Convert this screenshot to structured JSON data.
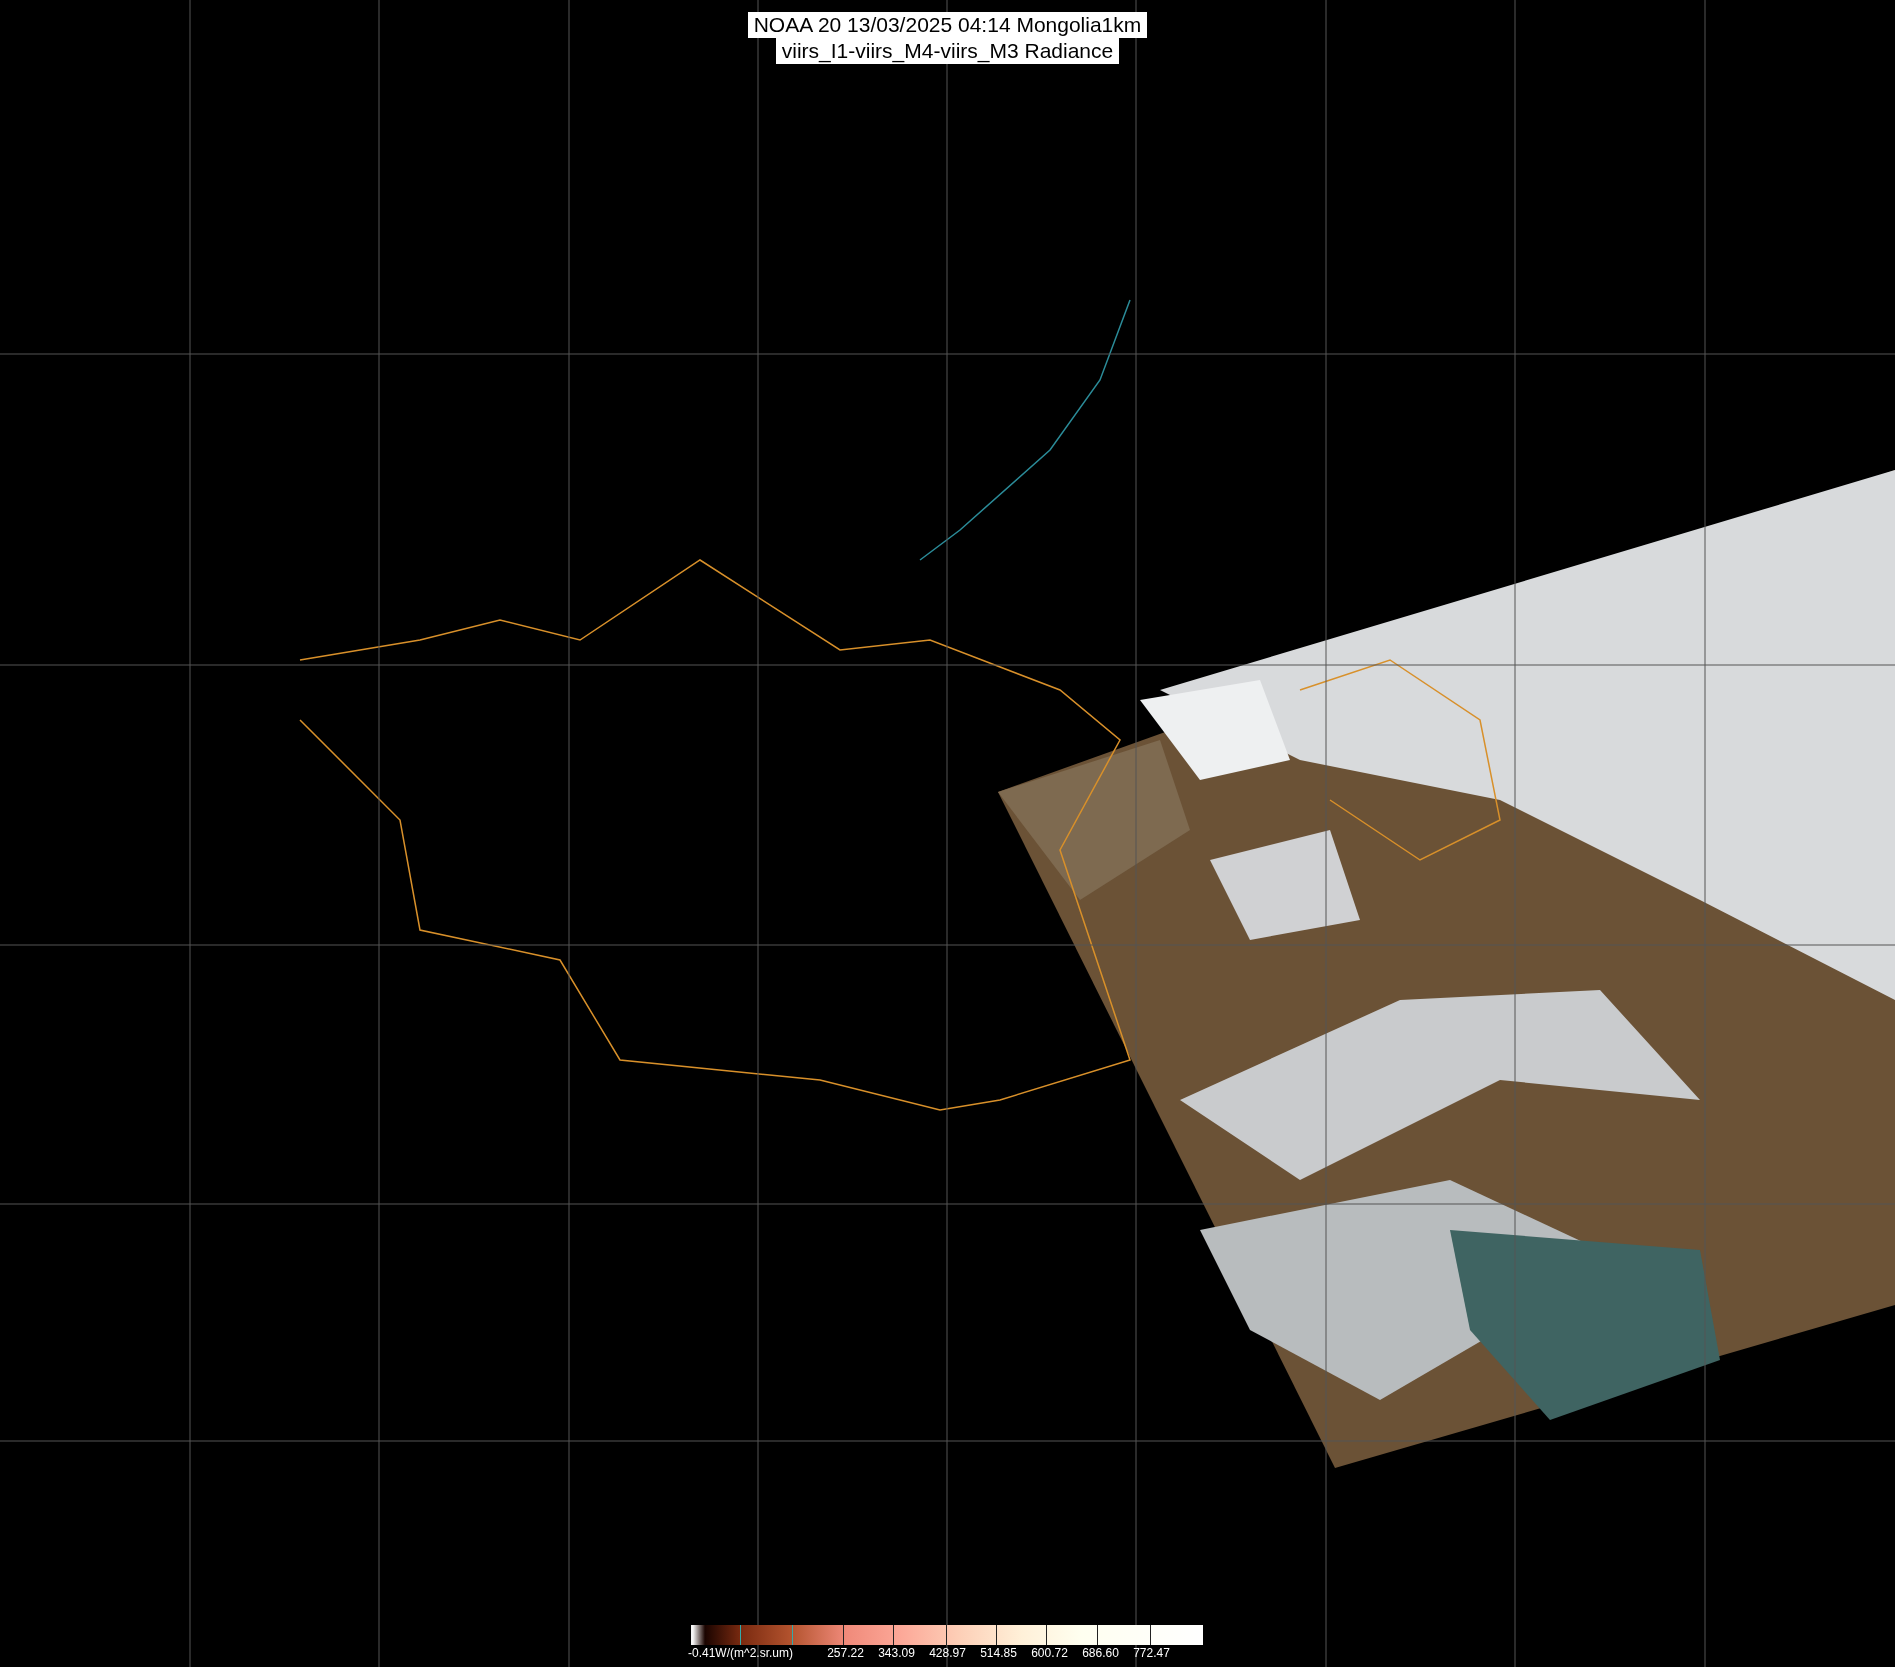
{
  "title": {
    "lines": [
      "NOAA 20 13/03/2025 04:14 Mongolia1km",
      "viirs_I1-viirs_M4-viirs_M3 Radiance"
    ]
  },
  "colorbar": {
    "labels": [
      "-0.41W/(m^2.sr.um)",
      "257.22",
      "343.09",
      "428.97",
      "514.85",
      "600.72",
      "686.60",
      "772.47"
    ]
  }
}
